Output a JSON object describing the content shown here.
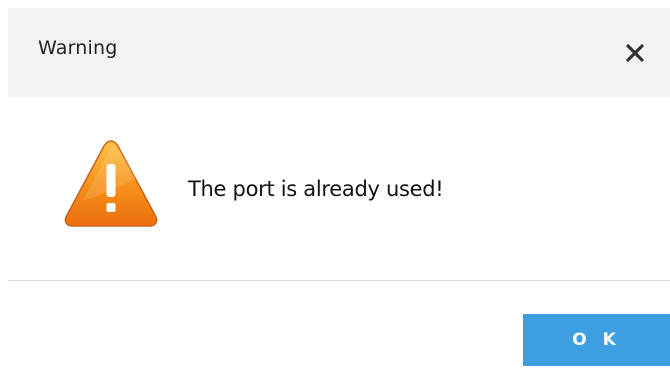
{
  "dialog": {
    "title": "Warning",
    "close_icon": "close-icon",
    "icon": "warning-triangle-icon",
    "message": "The port is already used!",
    "ok_label": "O K"
  },
  "colors": {
    "titlebar_bg": "#f5f2f5",
    "ok_button_bg": "#3d9fe2",
    "warning_orange": "#f59a1e"
  }
}
